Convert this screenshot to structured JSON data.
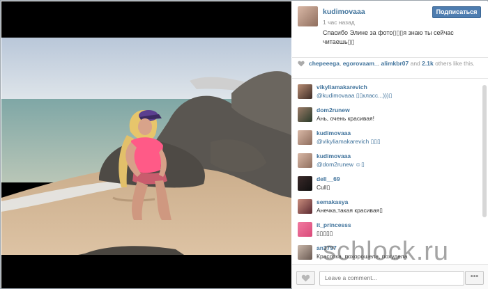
{
  "post": {
    "username": "kudimovaaa",
    "follow_label": "Подписаться",
    "time": "1 час назад",
    "caption": "Спасибо Элине за фото▯▯▯я знаю ты сейчас читаешь▯▯"
  },
  "likes": {
    "names": [
      "chepeeega",
      "egorovaam_",
      "alimkbr07"
    ],
    "and_word": "and",
    "count": "2.1k",
    "suffix": "others like this."
  },
  "comments": [
    {
      "user": "vikyliamakarevich",
      "text": "@kudimovaaa ▯▯класс...)))▯"
    },
    {
      "user": "dom2runew",
      "text": "Ань, очень красивая!"
    },
    {
      "user": "kudimovaaa",
      "text": "@vikyliamakarevich ▯▯▯"
    },
    {
      "user": "kudimovaaa",
      "text": "@dom2runew ☺▯"
    },
    {
      "user": "dell__69",
      "text": "Cull▯"
    },
    {
      "user": "semakasya",
      "text": "Анечка,такая красивая▯"
    },
    {
      "user": "it_princesss",
      "text": "▯▯▯▯▯"
    },
    {
      "user": "an3797",
      "text": "Красотка, похорошела, похудела"
    }
  ],
  "footer": {
    "comment_placeholder": "Leave a comment...",
    "more_label": "•••"
  },
  "watermark": "schlock.ru",
  "colors": {
    "accent": "#3f729b",
    "button": "#4e7db0"
  }
}
